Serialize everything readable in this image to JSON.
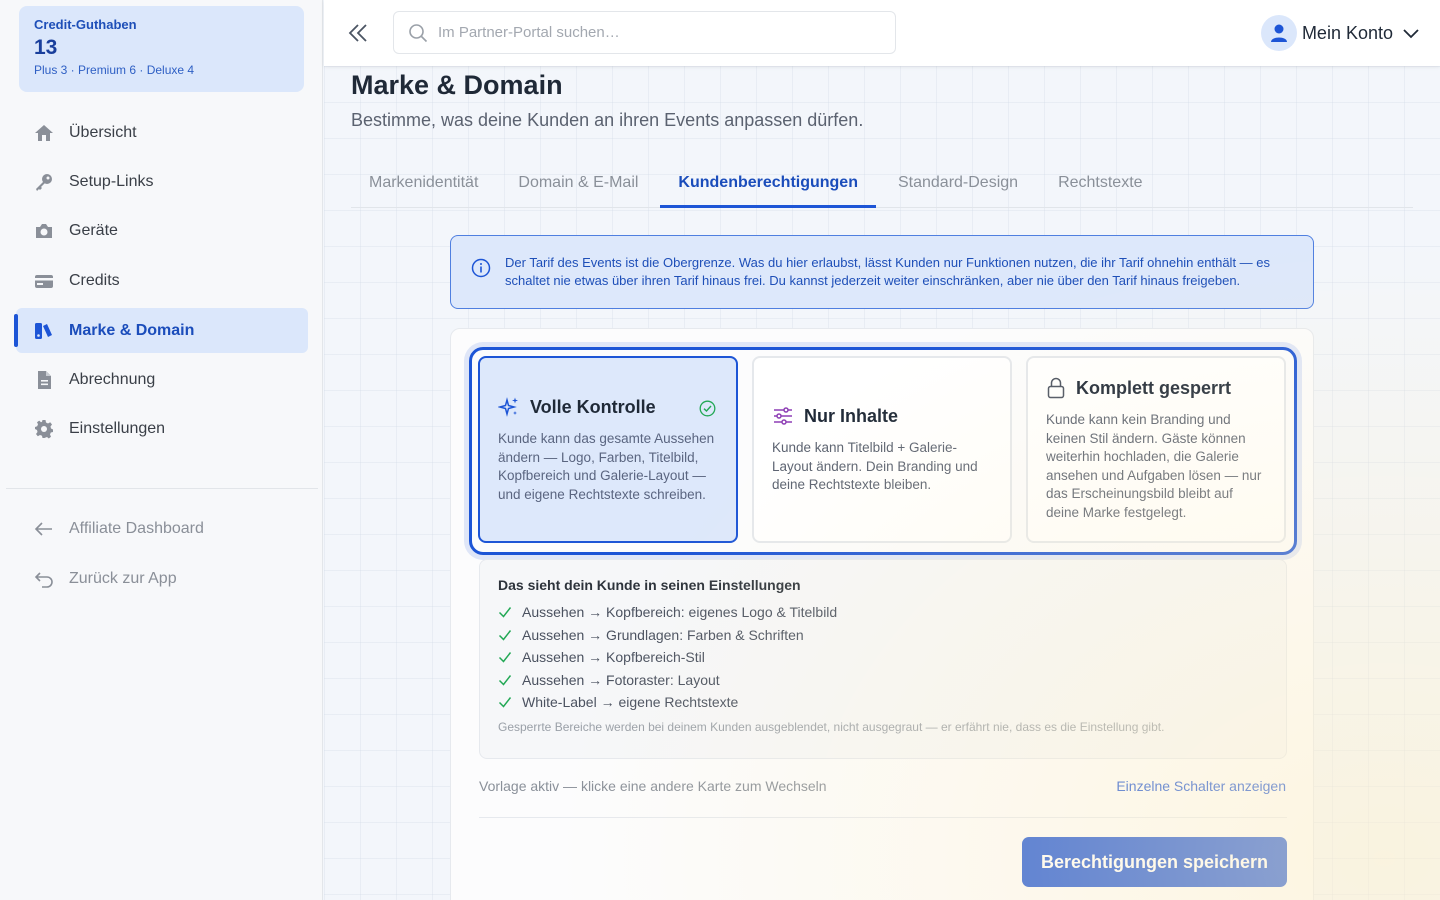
{
  "credits": {
    "title": "Credit-Guthaben",
    "value": "13",
    "breakdown": "Plus 3 · Premium 6 · Deluxe 4"
  },
  "sidebar": {
    "items": [
      {
        "label": "Übersicht",
        "icon": "home-icon"
      },
      {
        "label": "Setup-Links",
        "icon": "key-icon"
      },
      {
        "label": "Geräte",
        "icon": "camera-icon"
      },
      {
        "label": "Credits",
        "icon": "credit-card-icon"
      },
      {
        "label": "Marke & Domain",
        "icon": "brand-icon",
        "active": true
      },
      {
        "label": "Abrechnung",
        "icon": "document-icon"
      },
      {
        "label": "Einstellungen",
        "icon": "gear-icon"
      }
    ],
    "footer_items": [
      {
        "label": "Affiliate Dashboard",
        "icon": "arrow-left-icon"
      },
      {
        "label": "Zurück zur App",
        "icon": "undo-icon"
      }
    ]
  },
  "topbar": {
    "search_placeholder": "Im Partner-Portal suchen…",
    "account_label": "Mein Konto"
  },
  "page": {
    "title": "Marke & Domain",
    "subtitle": "Bestimme, was deine Kunden an ihren Events anpassen dürfen."
  },
  "tabs": [
    {
      "label": "Markenidentität"
    },
    {
      "label": "Domain & E-Mail"
    },
    {
      "label": "Kundenberechtigungen",
      "active": true
    },
    {
      "label": "Standard-Design"
    },
    {
      "label": "Rechtstexte"
    }
  ],
  "info_text": "Der Tarif des Events ist die Obergrenze. Was du hier erlaubst, lässt Kunden nur Funktionen nutzen, die ihr Tarif ohnehin enthält — es schaltet nie etwas über ihren Tarif hinaus frei. Du kannst jederzeit weiter einschränken, aber nie über den Tarif hinaus freigeben.",
  "cards": [
    {
      "title": "Volle Kontrolle",
      "icon": "sparkles-icon",
      "selected": true,
      "description": "Kunde kann das gesamte Aussehen ändern — Logo, Farben, Titelbild, Kopfbereich und Galerie-Layout — und eigene Rechtstexte schreiben."
    },
    {
      "title": "Nur Inhalte",
      "icon": "sliders-icon",
      "selected": false,
      "description": "Kunde kann Titelbild + Galerie-Layout ändern. Dein Branding und deine Rechtstexte bleiben."
    },
    {
      "title": "Komplett gesperrt",
      "icon": "lock-icon",
      "selected": false,
      "description": "Kunde kann kein Branding und keinen Stil ändern. Gäste können weiterhin hochladen, die Galerie ansehen und Aufgaben lösen — nur das Erscheinungsbild bleibt auf deine Marke festgelegt."
    }
  ],
  "preview": {
    "title": "Das sieht dein Kunde in seinen Einstellungen",
    "permissions": [
      "Aussehen → Kopfbereich: eigenes Logo & Titelbild",
      "Aussehen → Grundlagen: Farben & Schriften",
      "Aussehen → Kopfbereich-Stil",
      "Aussehen → Fotoraster: Layout",
      "White-Label → eigene Rechtstexte"
    ],
    "note": "Gesperrte Bereiche werden bei deinem Kunden ausgeblendet, nicht ausgegraut — er erfährt nie, dass es die Einstellung gibt."
  },
  "footer": {
    "status": "Vorlage aktiv — klicke eine andere Karte zum Wechseln",
    "toggle_link": "Einzelne Schalter anzeigen",
    "save_label": "Berechtigungen speichern"
  },
  "colors": {
    "accent": "#1d55d6",
    "accent_light": "#dbe7fb",
    "success": "#22a855"
  }
}
